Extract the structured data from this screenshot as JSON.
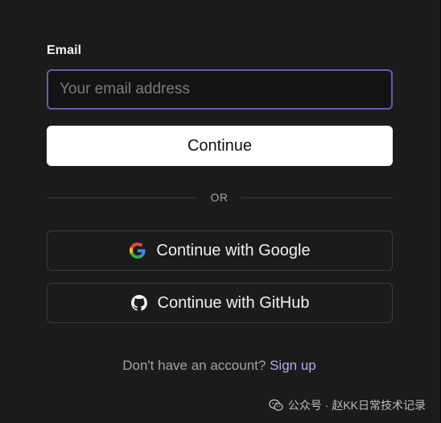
{
  "form": {
    "email_label": "Email",
    "email_placeholder": "Your email address",
    "email_value": "",
    "continue_label": "Continue"
  },
  "divider": {
    "label": "OR"
  },
  "oauth": {
    "google_label": "Continue with Google",
    "github_label": "Continue with GitHub",
    "google_icon": "google-icon",
    "github_icon": "github-icon"
  },
  "signup": {
    "prompt": "Don't have an account?",
    "link_label": "Sign up"
  },
  "watermark": {
    "text": "公众号 · 赵KK日常技术记录",
    "icon": "wechat-icon"
  },
  "colors": {
    "background": "#1b1b1c",
    "input_focus_border": "#6a5bb0",
    "link": "#b5a8f0",
    "primary_button": "#ffffff"
  }
}
